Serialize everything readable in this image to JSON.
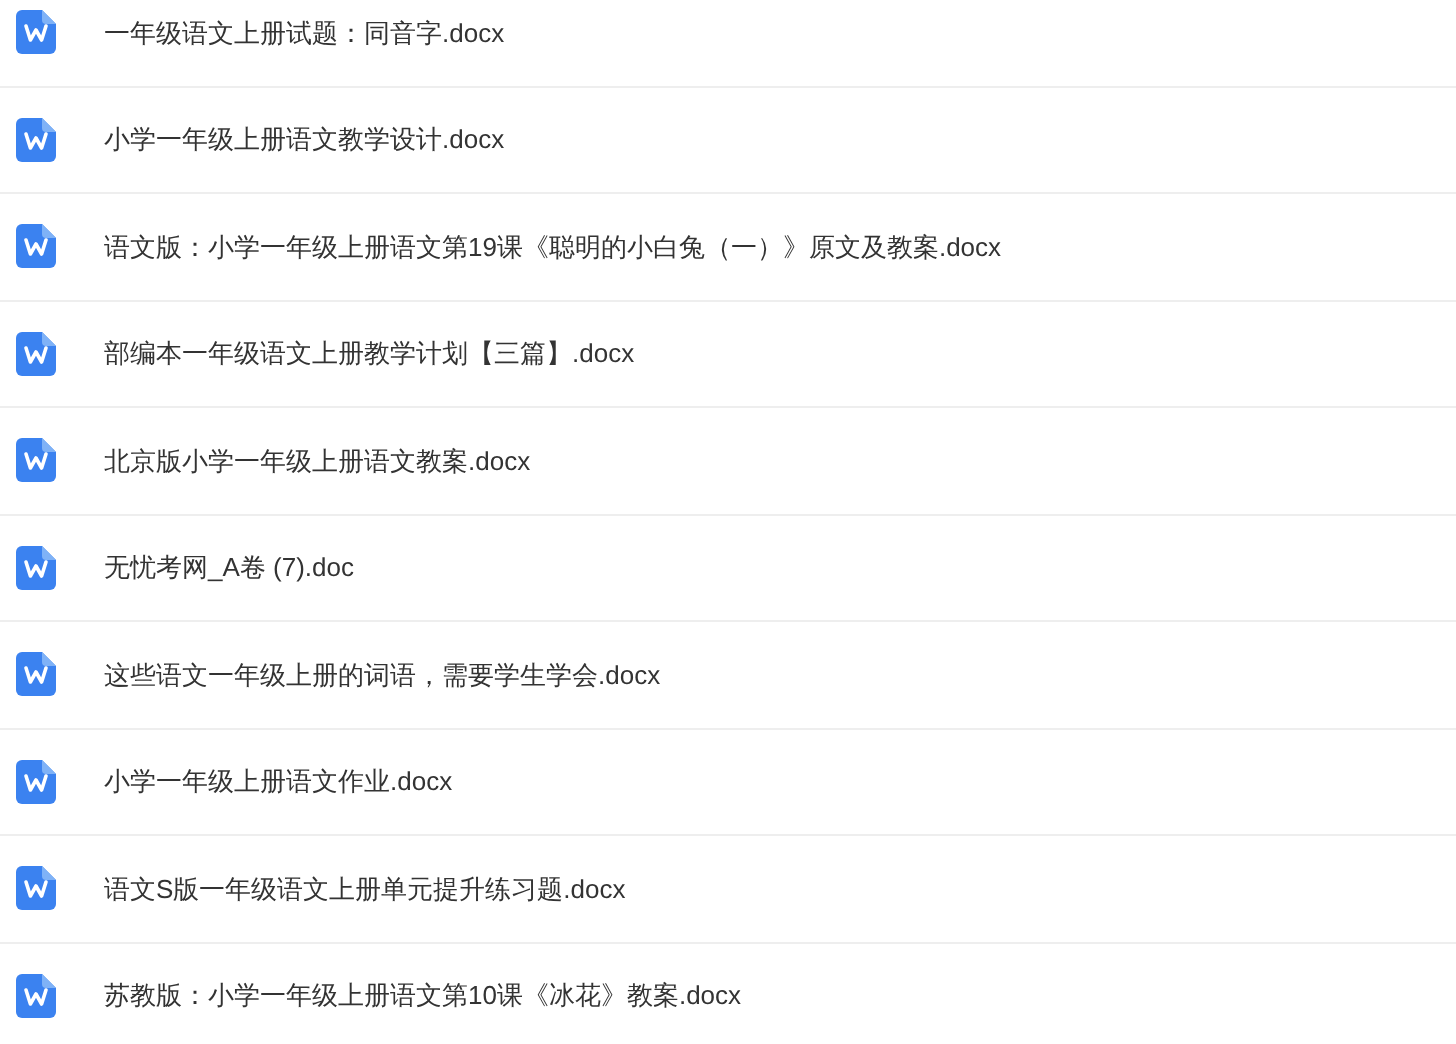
{
  "files": [
    {
      "name": "一年级语文上册试题：同音字.docx"
    },
    {
      "name": "小学一年级上册语文教学设计.docx"
    },
    {
      "name": "语文版：小学一年级上册语文第19课《聪明的小白兔（一）》原文及教案.docx"
    },
    {
      "name": "部编本一年级语文上册教学计划【三篇】.docx"
    },
    {
      "name": "北京版小学一年级上册语文教案.docx"
    },
    {
      "name": "无忧考网_A卷 (7).doc"
    },
    {
      "name": "这些语文一年级上册的词语，需要学生学会.docx"
    },
    {
      "name": "小学一年级上册语文作业.docx"
    },
    {
      "name": "语文S版一年级语文上册单元提升练习题.docx"
    },
    {
      "name": "苏教版：小学一年级上册语文第10课《冰花》教案.docx"
    }
  ]
}
